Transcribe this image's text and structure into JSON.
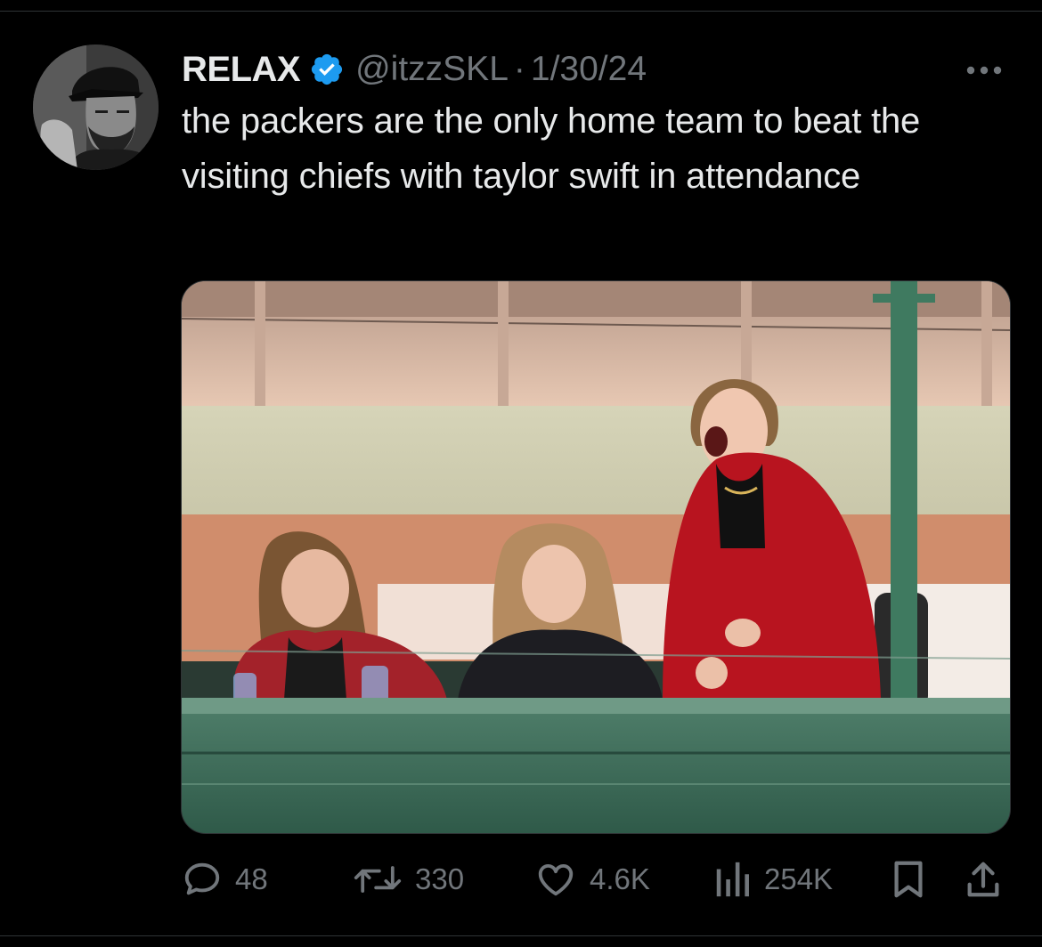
{
  "tweet": {
    "display_name": "RELAX",
    "verified_icon": "verified-badge-icon",
    "handle": "@itzzSKL",
    "separator": "·",
    "date": "1/30/24",
    "text": "the packers are the only home team to beat the visiting chiefs with taylor swift in attendance",
    "more_icon": "more-options-icon"
  },
  "media": {
    "type": "photo"
  },
  "actions": {
    "reply": {
      "icon": "reply-icon",
      "count": "48"
    },
    "retweet": {
      "icon": "retweet-icon",
      "count": "330"
    },
    "like": {
      "icon": "heart-icon",
      "count": "4.6K"
    },
    "views": {
      "icon": "views-chart-icon",
      "count": "254K"
    },
    "bookmark": {
      "icon": "bookmark-icon"
    },
    "share": {
      "icon": "share-icon"
    }
  },
  "colors": {
    "background": "#000000",
    "text_primary": "#e7e9ea",
    "text_secondary": "#71767b",
    "verified_blue": "#1d9bf0",
    "divider": "#2f3336"
  }
}
